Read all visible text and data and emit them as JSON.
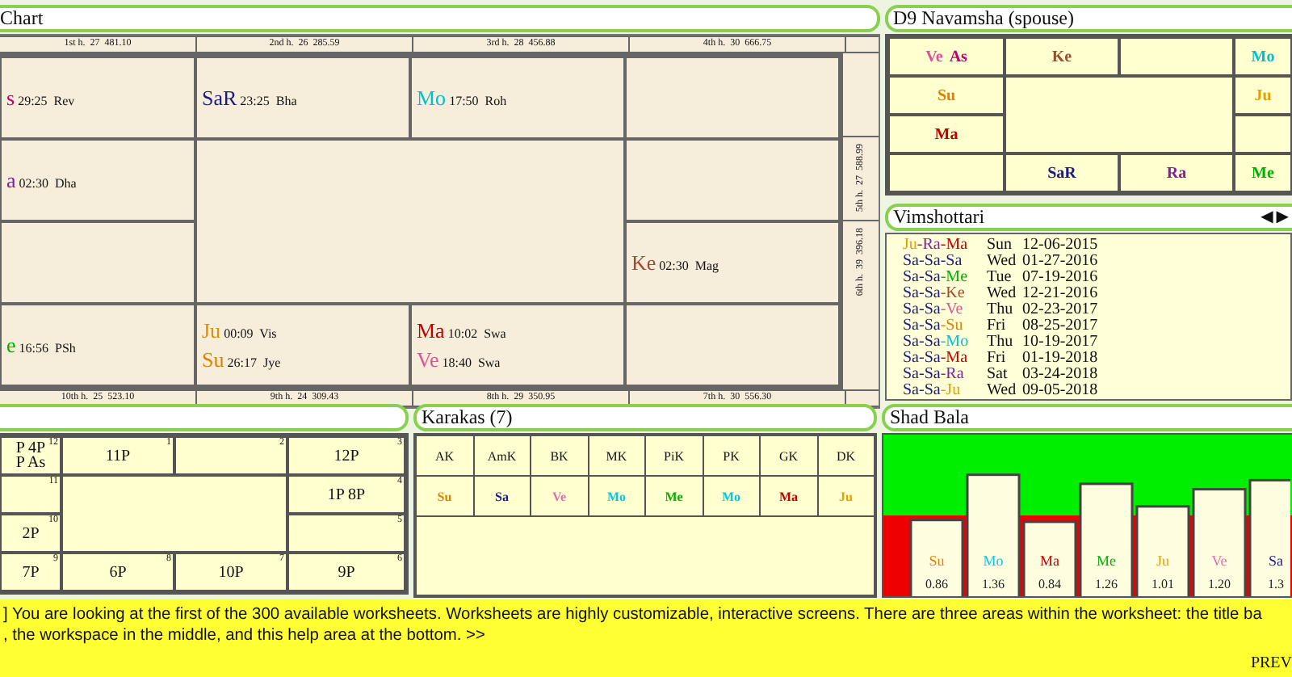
{
  "chart": {
    "title": "Chart",
    "top_labels": [
      "1st h.  27  481.10",
      "2nd h.  26  285.59",
      "3rd h.  28  456.88",
      "4th h.  30  666.75"
    ],
    "side_labels": [
      "5th h.  27  588.99",
      "6th h.  39  396.18"
    ],
    "bottom_labels": [
      "10th h.  25  523.10",
      "9th h.  24  309.43",
      "8th h.  29  350.95",
      "7th h.  30  556.30"
    ],
    "cells": [
      {
        "planets": [
          {
            "name": "s",
            "degree": "29:25",
            "nakshatra": "Rev",
            "color": "#c0006f"
          }
        ]
      },
      {
        "planets": [
          {
            "name": "SaR",
            "degree": "23:25",
            "nakshatra": "Bha",
            "color": "#1a1a80"
          }
        ]
      },
      {
        "planets": [
          {
            "name": "Mo",
            "degree": "17:50",
            "nakshatra": "Roh",
            "color": "#00c0d0"
          }
        ]
      },
      {},
      {
        "planets": [
          {
            "name": "a",
            "degree": "02:30",
            "nakshatra": "Dha",
            "color": "#8020a0"
          }
        ]
      },
      {},
      {},
      {
        "planets": [
          {
            "name": "Ke",
            "degree": "02:30",
            "nakshatra": "Mag",
            "color": "#a04a30"
          }
        ]
      },
      {
        "planets": [
          {
            "name": "e",
            "degree": "16:56",
            "nakshatra": "PSh",
            "color": "#00b000"
          }
        ]
      },
      {
        "planets": [
          {
            "name": "Ju",
            "degree": "00:09",
            "nakshatra": "Vis",
            "color": "#e09000"
          },
          {
            "name": "Su",
            "degree": "26:17",
            "nakshatra": "Jye",
            "color": "#e08000"
          }
        ]
      },
      {
        "planets": [
          {
            "name": "Ma",
            "degree": "10:02",
            "nakshatra": "Swa",
            "color": "#c00000"
          },
          {
            "name": "Ve",
            "degree": "18:40",
            "nakshatra": "Swa",
            "color": "#e0509a"
          }
        ]
      },
      {}
    ]
  },
  "navamsha": {
    "title": "D9 Navamsha  (spouse)",
    "cells": [
      {
        "planets": [
          {
            "name": "Ve",
            "color": "#e0509a"
          },
          {
            "name": "As",
            "color": "#c0006f"
          }
        ]
      },
      {
        "planets": [
          {
            "name": "Ke",
            "color": "#a04a30"
          }
        ]
      },
      {},
      {
        "planets": [
          {
            "name": "Mo",
            "color": "#00c0d0"
          }
        ]
      },
      {
        "planets": [
          {
            "name": "Su",
            "color": "#e08000"
          }
        ]
      },
      {
        "planets": [
          {
            "name": "Ju",
            "color": "#e0a000"
          }
        ]
      },
      {
        "planets": [
          {
            "name": "Ma",
            "color": "#c00000"
          }
        ]
      },
      {},
      {},
      {
        "planets": [
          {
            "name": "SaR",
            "color": "#1a1a80"
          }
        ]
      },
      {
        "planets": [
          {
            "name": "Ra",
            "color": "#8020a0"
          }
        ]
      },
      {
        "planets": [
          {
            "name": "Me",
            "color": "#00b000"
          }
        ]
      }
    ]
  },
  "vimshottari": {
    "title": "Vimshottari",
    "prev_arrow": "◀",
    "next_arrow": "▶",
    "periods": [
      {
        "lords": [
          {
            "name": "Ju",
            "color": "#e0a000"
          },
          {
            "name": "-Ra",
            "color": "#8020a0"
          },
          {
            "name": "-Ma",
            "color": "#c00000"
          }
        ],
        "day": "Sun",
        "date": "12-06-2015"
      },
      {
        "lords": [
          {
            "name": "Sa",
            "color": "#1a1a80"
          },
          {
            "name": "-Sa",
            "color": "#1a1a80"
          },
          {
            "name": "-Sa",
            "color": "#1a1a80"
          }
        ],
        "day": "Wed",
        "date": "01-27-2016"
      },
      {
        "lords": [
          {
            "name": "Sa",
            "color": "#1a1a80"
          },
          {
            "name": "-Sa",
            "color": "#1a1a80"
          },
          {
            "name": "-Me",
            "color": "#00b000"
          }
        ],
        "day": "Tue",
        "date": "07-19-2016"
      },
      {
        "lords": [
          {
            "name": "Sa",
            "color": "#1a1a80"
          },
          {
            "name": "-Sa",
            "color": "#1a1a80"
          },
          {
            "name": "-Ke",
            "color": "#a04a30"
          }
        ],
        "day": "Wed",
        "date": "12-21-2016"
      },
      {
        "lords": [
          {
            "name": "Sa",
            "color": "#1a1a80"
          },
          {
            "name": "-Sa",
            "color": "#1a1a80"
          },
          {
            "name": "-Ve",
            "color": "#e0509a"
          }
        ],
        "day": "Thu",
        "date": "02-23-2017"
      },
      {
        "lords": [
          {
            "name": "Sa",
            "color": "#1a1a80"
          },
          {
            "name": "-Sa",
            "color": "#1a1a80"
          },
          {
            "name": "-Su",
            "color": "#e08000"
          }
        ],
        "day": "Fri",
        "date": "08-25-2017"
      },
      {
        "lords": [
          {
            "name": "Sa",
            "color": "#1a1a80"
          },
          {
            "name": "-Sa",
            "color": "#1a1a80"
          },
          {
            "name": "-Mo",
            "color": "#00c0d0"
          }
        ],
        "day": "Thu",
        "date": "10-19-2017"
      },
      {
        "lords": [
          {
            "name": "Sa",
            "color": "#1a1a80"
          },
          {
            "name": "-Sa",
            "color": "#1a1a80"
          },
          {
            "name": "-Ma",
            "color": "#c00000"
          }
        ],
        "day": "Fri",
        "date": "01-19-2018"
      },
      {
        "lords": [
          {
            "name": "Sa",
            "color": "#1a1a80"
          },
          {
            "name": "-Sa",
            "color": "#1a1a80"
          },
          {
            "name": "-Ra",
            "color": "#8020a0"
          }
        ],
        "day": "Sat",
        "date": "03-24-2018"
      },
      {
        "lords": [
          {
            "name": "Sa",
            "color": "#1a1a80"
          },
          {
            "name": "-Sa",
            "color": "#1a1a80"
          },
          {
            "name": "-Ju",
            "color": "#e0a000"
          }
        ],
        "day": "Wed",
        "date": "09-05-2018"
      }
    ]
  },
  "houses_chart": {
    "cells": [
      {
        "number": "12",
        "lines": [
          "P 4P",
          "P As"
        ]
      },
      {
        "number": "1",
        "lines": [
          "11P"
        ]
      },
      {
        "number": "2"
      },
      {
        "number": "3",
        "lines": [
          "12P"
        ]
      },
      {
        "number": "11"
      },
      {
        "number": "4",
        "lines": [
          "1P 8P"
        ]
      },
      {
        "number": "10",
        "lines": [
          "2P"
        ]
      },
      {
        "number": "5"
      },
      {
        "number": "9",
        "lines": [
          "7P"
        ]
      },
      {
        "number": "8",
        "lines": [
          "6P"
        ]
      },
      {
        "number": "7",
        "lines": [
          "10P"
        ]
      },
      {
        "number": "6",
        "lines": [
          "9P"
        ]
      }
    ]
  },
  "karakas": {
    "title": "Karakas (7)",
    "columns": [
      "AK",
      "AmK",
      "BK",
      "MK",
      "PiK",
      "PK",
      "GK",
      "DK"
    ],
    "values": [
      {
        "name": "Su",
        "color": "#e08000"
      },
      {
        "name": "Sa",
        "color": "#1a1a80"
      },
      {
        "name": "Ve",
        "color": "#e070b0"
      },
      {
        "name": "Mo",
        "color": "#00c8e0"
      },
      {
        "name": "Me",
        "color": "#00b000"
      },
      {
        "name": "Mo",
        "color": "#00c8e0"
      },
      {
        "name": "Ma",
        "color": "#c00000"
      },
      {
        "name": "Ju",
        "color": "#e0a000"
      }
    ]
  },
  "shad_bala": {
    "title": "Shad Bala",
    "chart_data": {
      "type": "bar",
      "categories": [
        "Su",
        "Mo",
        "Ma",
        "Me",
        "Ju",
        "Ve",
        "Sa"
      ],
      "values": [
        0.86,
        1.36,
        0.84,
        1.26,
        1.01,
        1.2,
        1.3
      ],
      "value_labels": [
        "0.86",
        "1.36",
        "0.84",
        "1.26",
        "1.01",
        "1.20",
        "1.3"
      ]
    },
    "bar_labels": [
      {
        "color": "#e08000"
      },
      {
        "color": "#00c8e0"
      },
      {
        "color": "#c00000"
      },
      {
        "color": "#00b000"
      },
      {
        "color": "#e0a000"
      },
      {
        "color": "#e070b0"
      },
      {
        "color": "#1a1a80"
      }
    ]
  },
  "help": {
    "lines": [
      "] You are looking at the first of the 300 available worksheets. Worksheets are highly customizable, interactive screens. There are three areas within the worksheet: the title ba",
      ", the workspace in the middle, and this help area at the bottom. >>"
    ],
    "prev": "PREV"
  }
}
